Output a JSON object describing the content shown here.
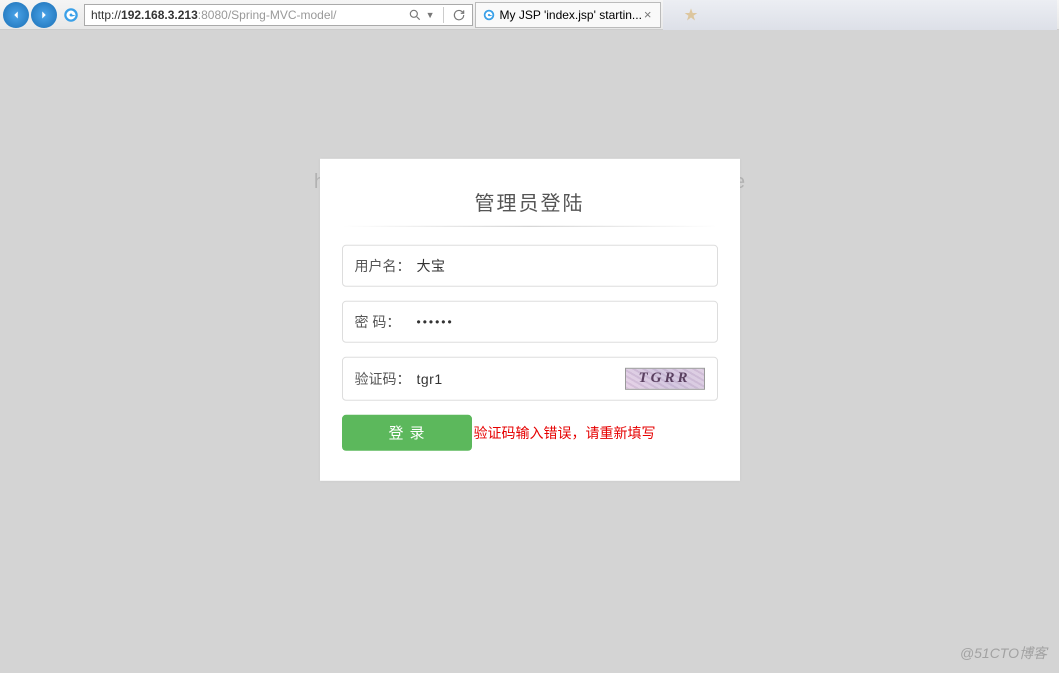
{
  "browser": {
    "url_prefix": "http://",
    "url_host": "192.168.3.213",
    "url_port": ":8080",
    "url_path": "/Spring-MVC-model/",
    "tab_title": "My JSP 'index.jsp' startin..."
  },
  "watermark": "http://blog.csdn.net/dfBeautifulLive",
  "bottom_watermark": "@51CTO博客",
  "login": {
    "title": "管理员登陆",
    "username_label": "用户名：",
    "username_value": "大宝",
    "password_label": "密  码：",
    "password_value": "••••••",
    "captcha_label": "验证码：",
    "captcha_value": "tgr1",
    "captcha_image_text": "TGRR",
    "submit_label": "登录",
    "error_message": "验证码输入错误，请重新填写"
  }
}
